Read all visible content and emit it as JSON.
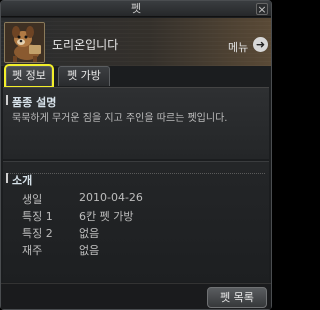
{
  "window": {
    "title": "펫",
    "close_glyph": "×"
  },
  "header": {
    "pet_name": "도리온입니다",
    "menu_label": "메뉴",
    "menu_arrow": "➜",
    "avatar_icon": "dog-pet-icon"
  },
  "tabs": [
    {
      "label": "펫 정보",
      "active": true
    },
    {
      "label": "펫 가방",
      "active": false
    }
  ],
  "description": {
    "title": "품종 설명",
    "text": "묵묵하게 무거운 짐을 지고 주인을 따르는 펫입니다."
  },
  "intro": {
    "title": "소개",
    "rows": [
      {
        "label": "생일",
        "value": "2010-04-26"
      },
      {
        "label": "특징 1",
        "value": "6칸 펫 가방"
      },
      {
        "label": "특징 2",
        "value": "없음"
      },
      {
        "label": "재주",
        "value": "없음"
      }
    ]
  },
  "footer": {
    "pet_list_button": "펫 목록"
  },
  "colors": {
    "tab_highlight": "#f2ee2a"
  }
}
